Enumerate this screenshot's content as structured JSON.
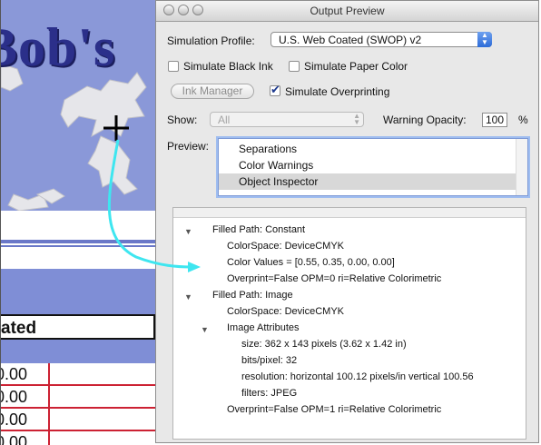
{
  "background_doc": {
    "banner_text": "Bob's",
    "heading": "ated",
    "cells": [
      "0.00",
      "0.00",
      "0.00",
      "0.00"
    ]
  },
  "window": {
    "title": "Output Preview"
  },
  "simulation": {
    "label": "Simulation Profile:",
    "value": "U.S. Web Coated (SWOP) v2",
    "black_ink_label": "Simulate Black Ink",
    "black_ink_checked": false,
    "paper_color_label": "Simulate Paper Color",
    "paper_color_checked": false,
    "ink_manager_label": "Ink Manager",
    "overprinting_label": "Simulate Overprinting",
    "overprinting_checked": true
  },
  "show": {
    "label": "Show:",
    "value": "All",
    "warning_label": "Warning Opacity:",
    "warning_value": "100",
    "warning_unit": "%"
  },
  "preview": {
    "label": "Preview:",
    "items": [
      "Separations",
      "Color Warnings",
      "Object Inspector"
    ],
    "selected": "Object Inspector"
  },
  "inspector": {
    "lines": [
      "Filled Path: Constant",
      "ColorSpace: DeviceCMYK",
      "Color Values = [0.55, 0.35, 0.00, 0.00]",
      "Overprint=False OPM=0 ri=Relative Colorimetric",
      "Filled Path: Image",
      "ColorSpace: DeviceCMYK",
      "Image Attributes",
      "size: 362 x 143 pixels (3.62 x 1.42 in)",
      "bits/pixel: 32",
      "resolution: horizontal 100.12 pixels/in vertical 100.56",
      "filters: JPEG",
      "Overprint=False OPM=1 ri=Relative Colorimetric"
    ]
  },
  "colors": {
    "accent_select": "#2c6bd8",
    "banner": "#8a98d8",
    "annotation_arrow": "#3ee6f0",
    "table_lines": "#cc2233"
  },
  "icons": {
    "cursor": "crosshair-cursor-icon"
  }
}
